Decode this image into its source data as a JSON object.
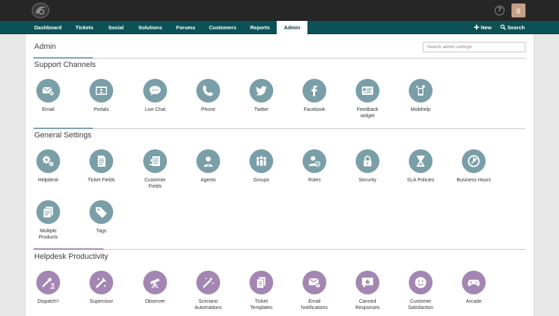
{
  "nav": {
    "items": [
      {
        "label": "Dashboard"
      },
      {
        "label": "Tickets"
      },
      {
        "label": "Social"
      },
      {
        "label": "Solutions"
      },
      {
        "label": "Forums"
      },
      {
        "label": "Customers"
      },
      {
        "label": "Reports"
      },
      {
        "label": "Admin"
      }
    ],
    "new_label": "New",
    "search_label": "Search",
    "help_glyph": "?",
    "avatar_initial": "B"
  },
  "page": {
    "title": "Admin",
    "search_placeholder": "Search admin settings"
  },
  "colors": {
    "navbar": "#0b5257",
    "teal_icon": "#7a9fa8",
    "purple_icon": "#a486b2"
  },
  "sections": [
    {
      "title": "Support Channels",
      "items": [
        {
          "label": "Email",
          "icon": "email-settings-icon"
        },
        {
          "label": "Portals",
          "icon": "portal-icon"
        },
        {
          "label": "Live Chat",
          "icon": "chat-icon"
        },
        {
          "label": "Phone",
          "icon": "phone-icon"
        },
        {
          "label": "Twitter",
          "icon": "twitter-icon"
        },
        {
          "label": "Facebook",
          "icon": "facebook-icon"
        },
        {
          "label": "Feedback\nwidget",
          "icon": "feedback-widget-icon"
        },
        {
          "label": "Mobihelp",
          "icon": "mobihelp-icon"
        }
      ]
    },
    {
      "title": "General Settings",
      "items": [
        {
          "label": "Helpdesk",
          "icon": "gears-icon"
        },
        {
          "label": "Ticket Fields",
          "icon": "ticket-fields-icon"
        },
        {
          "label": "Customer\nFields",
          "icon": "customer-fields-icon"
        },
        {
          "label": "Agents",
          "icon": "agent-icon"
        },
        {
          "label": "Groups",
          "icon": "groups-icon"
        },
        {
          "label": "Roles",
          "icon": "roles-icon"
        },
        {
          "label": "Security",
          "icon": "lock-icon"
        },
        {
          "label": "SLA Policies",
          "icon": "hourglass-icon"
        },
        {
          "label": "Business Hours",
          "icon": "clock-icon"
        },
        {
          "label": "Multiple\nProducts",
          "icon": "multiple-products-icon"
        },
        {
          "label": "Tags",
          "icon": "tag-icon"
        }
      ]
    },
    {
      "title": "Helpdesk Productivity",
      "items": [
        {
          "label": "Dispatch'r",
          "icon": "dispatcher-icon"
        },
        {
          "label": "Supervisor",
          "icon": "supervisor-icon"
        },
        {
          "label": "Observer",
          "icon": "telescope-icon"
        },
        {
          "label": "Scenario\nAutomations",
          "icon": "magic-wand-icon"
        },
        {
          "label": "Ticket\nTemplates",
          "icon": "ticket-templates-icon"
        },
        {
          "label": "Email\nNotifications",
          "icon": "email-notification-icon"
        },
        {
          "label": "Canned\nResponses",
          "icon": "canned-response-icon"
        },
        {
          "label": "Customer\nSatisfaction",
          "icon": "smiley-icon"
        },
        {
          "label": "Arcade",
          "icon": "gamepad-icon"
        }
      ]
    }
  ]
}
